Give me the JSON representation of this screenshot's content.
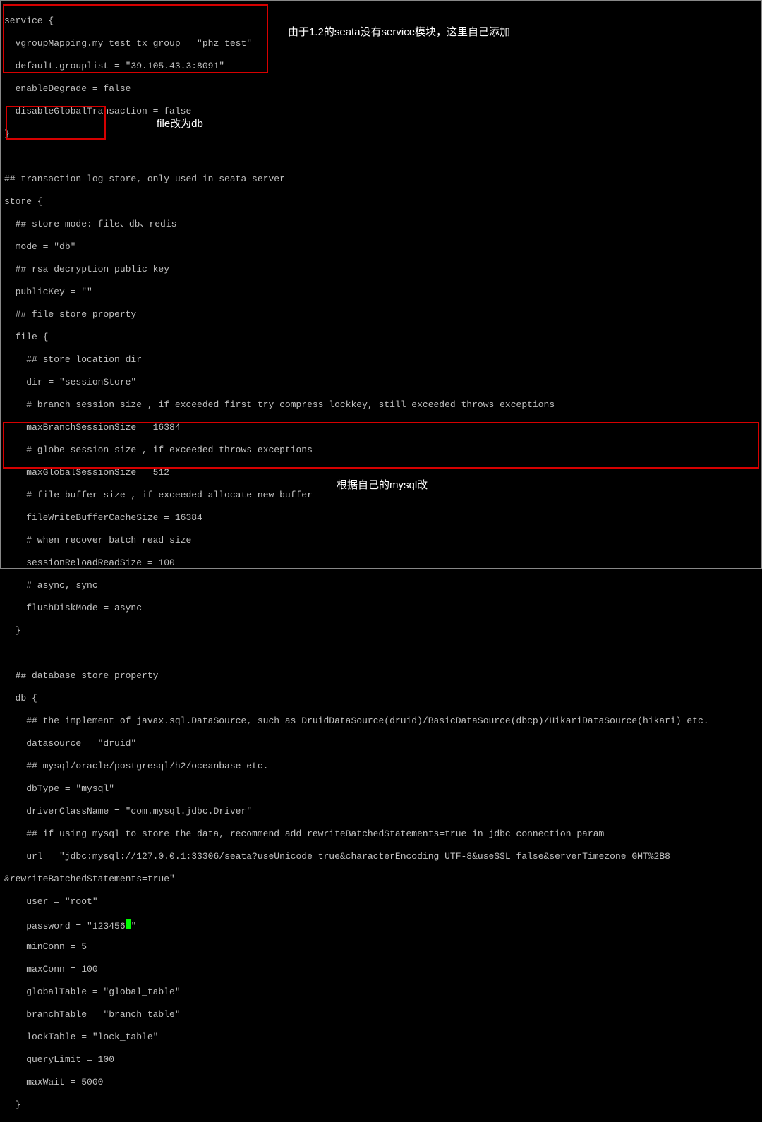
{
  "annotations": {
    "a1": "由于1.2的seata没有service模块，这里自己添加",
    "a2": "file改为db",
    "a3": "根据自己的mysql改"
  },
  "code": {
    "l1": "service {",
    "l2": "  vgroupMapping.my_test_tx_group = \"phz_test\"",
    "l3": "  default.grouplist = \"39.105.43.3:8091\"",
    "l4": "  enableDegrade = false",
    "l5": "  disableGlobalTransaction = false",
    "l6": "}",
    "l7": "",
    "l8": "## transaction log store, only used in seata-server",
    "l9": "store {",
    "l10": "  ## store mode: file、db、redis",
    "l11": "  mode = \"db\"",
    "l12": "  ## rsa decryption public key",
    "l13": "  publicKey = \"\"",
    "l14": "  ## file store property",
    "l15": "  file {",
    "l16": "    ## store location dir",
    "l17": "    dir = \"sessionStore\"",
    "l18": "    # branch session size , if exceeded first try compress lockkey, still exceeded throws exceptions",
    "l19": "    maxBranchSessionSize = 16384",
    "l20": "    # globe session size , if exceeded throws exceptions",
    "l21": "    maxGlobalSessionSize = 512",
    "l22": "    # file buffer size , if exceeded allocate new buffer",
    "l23": "    fileWriteBufferCacheSize = 16384",
    "l24": "    # when recover batch read size",
    "l25": "    sessionReloadReadSize = 100",
    "l26": "    # async, sync",
    "l27": "    flushDiskMode = async",
    "l28": "  }",
    "l29": "",
    "l30": "  ## database store property",
    "l31": "  db {",
    "l32": "    ## the implement of javax.sql.DataSource, such as DruidDataSource(druid)/BasicDataSource(dbcp)/HikariDataSource(hikari) etc.",
    "l33": "    datasource = \"druid\"",
    "l34": "    ## mysql/oracle/postgresql/h2/oceanbase etc.",
    "l35": "    dbType = \"mysql\"",
    "l36": "    driverClassName = \"com.mysql.jdbc.Driver\"",
    "l37": "    ## if using mysql to store the data, recommend add rewriteBatchedStatements=true in jdbc connection param",
    "l38": "    url = \"jdbc:mysql://127.0.0.1:33306/seata?useUnicode=true&characterEncoding=UTF-8&useSSL=false&serverTimezone=GMT%2B8",
    "l39": "&rewriteBatchedStatements=true\"",
    "l40": "    user = \"root\"",
    "l41a": "    password = \"123456",
    "l41b": "\"",
    "l42": "    minConn = 5",
    "l43": "    maxConn = 100",
    "l44": "    globalTable = \"global_table\"",
    "l45": "    branchTable = \"branch_table\"",
    "l46": "    lockTable = \"lock_table\"",
    "l47": "    queryLimit = 100",
    "l48": "    maxWait = 5000",
    "l49": "  }"
  }
}
